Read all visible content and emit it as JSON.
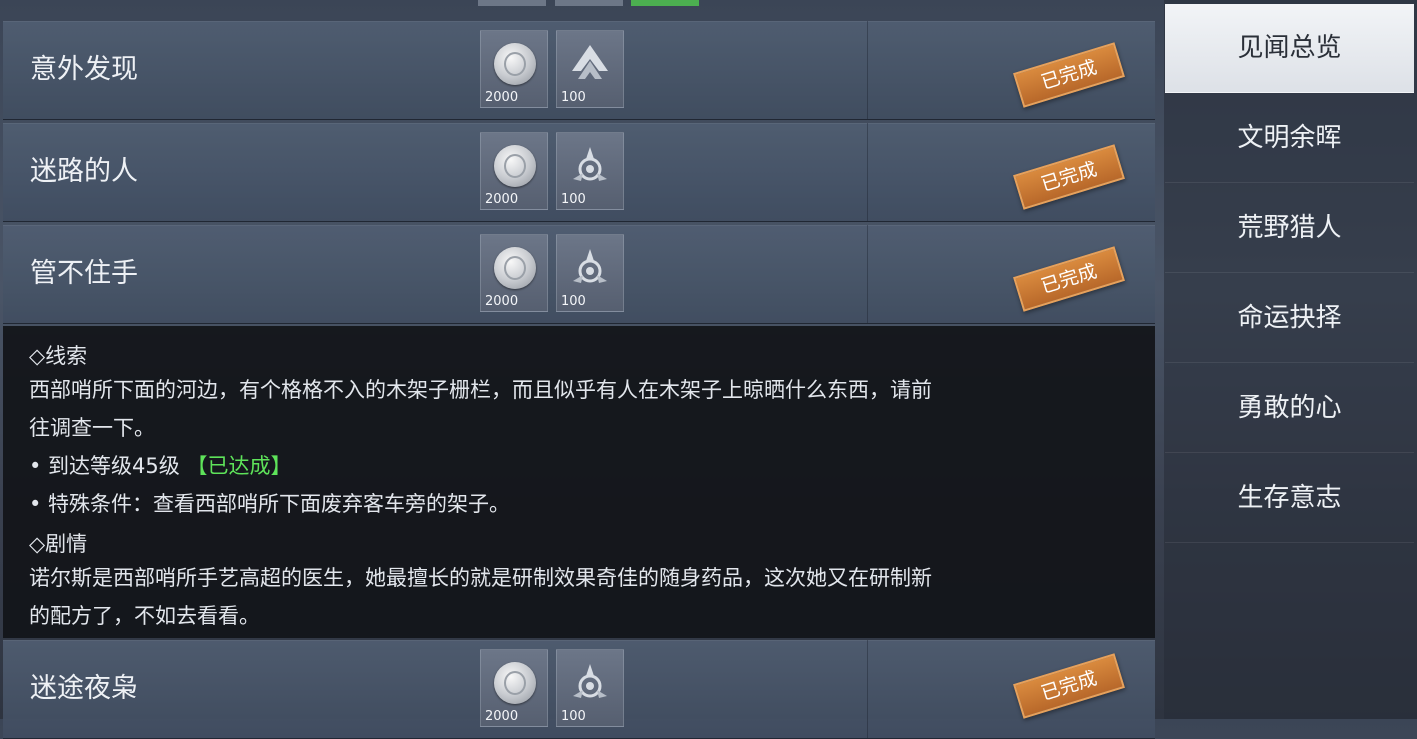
{
  "quests": [
    {
      "title": "意外发现",
      "status": "已完成",
      "rewards": [
        {
          "icon": "silver-coin-icon",
          "qty": "2000"
        },
        {
          "icon": "wing-emblem-icon",
          "qty": "100"
        }
      ]
    },
    {
      "title": "迷路的人",
      "status": "已完成",
      "rewards": [
        {
          "icon": "silver-coin-icon",
          "qty": "2000"
        },
        {
          "icon": "tripod-emblem-icon",
          "qty": "100"
        }
      ]
    },
    {
      "title": "管不住手",
      "status": "已完成",
      "rewards": [
        {
          "icon": "silver-coin-icon",
          "qty": "2000"
        },
        {
          "icon": "tripod-emblem-icon",
          "qty": "100"
        }
      ]
    },
    {
      "title": "迷途夜枭",
      "status": "已完成",
      "rewards": [
        {
          "icon": "silver-coin-icon",
          "qty": "2000"
        },
        {
          "icon": "tripod-emblem-icon",
          "qty": "100"
        }
      ]
    }
  ],
  "detail": {
    "clue_heading": "◇线索",
    "clue_line1": "西部哨所下面的河边，有个格格不入的木架子栅栏，而且似乎有人在木架子上晾晒什么东西，请前",
    "clue_line2": "往调查一下。",
    "req1_label": "• 到达等级45级",
    "req1_status": "【已达成】",
    "req2": "• 特殊条件：查看西部哨所下面废弃客车旁的架子。",
    "story_heading": "◇剧情",
    "story_line1": "诺尔斯是西部哨所手艺高超的医生，她最擅长的就是研制效果奇佳的随身药品，这次她又在研制新",
    "story_line2": "的配方了，不如去看看。"
  },
  "tabs": [
    "见闻总览",
    "文明余晖",
    "荒野猎人",
    "命运抉择",
    "勇敢的心",
    "生存意志"
  ],
  "active_tab": 0,
  "colors": {
    "stamp": "#c9763a",
    "req_done": "#5ee35a",
    "active_tab": "#eef0f3"
  }
}
